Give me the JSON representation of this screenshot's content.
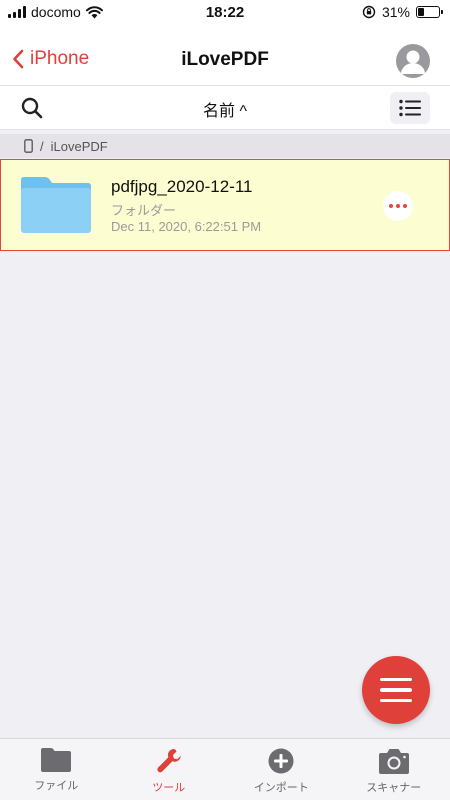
{
  "status_bar": {
    "carrier": "docomo",
    "time": "18:22",
    "battery": "31%",
    "battery_level": 0.31
  },
  "nav": {
    "back_label": "iPhone",
    "title": "iLovePDF"
  },
  "toolbar": {
    "sort_label": "名前 ^"
  },
  "breadcrumb": {
    "separator": "/",
    "folder": "iLovePDF"
  },
  "files": [
    {
      "name": "pdfjpg_2020-12-11",
      "type": "フォルダー",
      "date": "Dec 11, 2020, 6:22:51 PM"
    }
  ],
  "tabs": [
    {
      "label": "ファイル",
      "icon": "folder-icon",
      "active": false
    },
    {
      "label": "ツール",
      "icon": "wrench-icon",
      "active": true
    },
    {
      "label": "インポート",
      "icon": "plus-circle-icon",
      "active": false
    },
    {
      "label": "スキャナー",
      "icon": "camera-icon",
      "active": false
    }
  ],
  "colors": {
    "accent": "#e0403a",
    "highlight_row": "#fdfdd2",
    "background": "#efeff4"
  }
}
